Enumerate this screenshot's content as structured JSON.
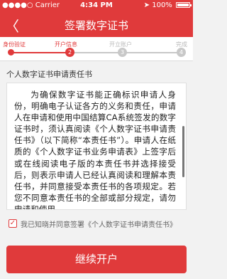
{
  "status_bar": {
    "carrier": "●●●●○ Carrier",
    "time": "4:34 PM",
    "battery": "100%",
    "signal_icon": "signal-dots-icon",
    "wifi_icon": "wifi-icon",
    "location_icon": "location-arrow-icon",
    "battery_icon": "battery-icon"
  },
  "nav": {
    "back_symbol": "〈",
    "title": "签署数字证书"
  },
  "steps": [
    {
      "label": "身份验证",
      "number": "",
      "state": "done"
    },
    {
      "label": "开户信息",
      "number": "2",
      "state": "active"
    },
    {
      "label": "开立账户",
      "number": "3",
      "state": "pending"
    },
    {
      "label": "完成",
      "number": "4",
      "state": "pending"
    }
  ],
  "colors": {
    "accent": "#e03a3b",
    "pending": "#c8c8c8"
  },
  "section_title": "个人数字证书申请责任书",
  "document_text": "为确保数字证书能正确标识申请人身份，明确电子认证各方的义务和责任，申请人在申请和使用中国结算CA系统签发的数字证书时，须认真阅读《个人数字证书申请责任书》（以下简称“本责任书”）。申请人在纸质的《个人数字证书业务申请表》上签字后或在线阅读电子版的本责任书并选择接受后，则表示申请人已经认真阅读和理解本责任书，并同意接受本责任书的各项规定。若您不同意本责任书的全部或部分规定，请勿申请和使用",
  "agree": {
    "checked": true,
    "check_mark": "✓",
    "text": "我已知晓并同意签署《个人数字证书申请责任书》"
  },
  "primary_button": "继续开户"
}
